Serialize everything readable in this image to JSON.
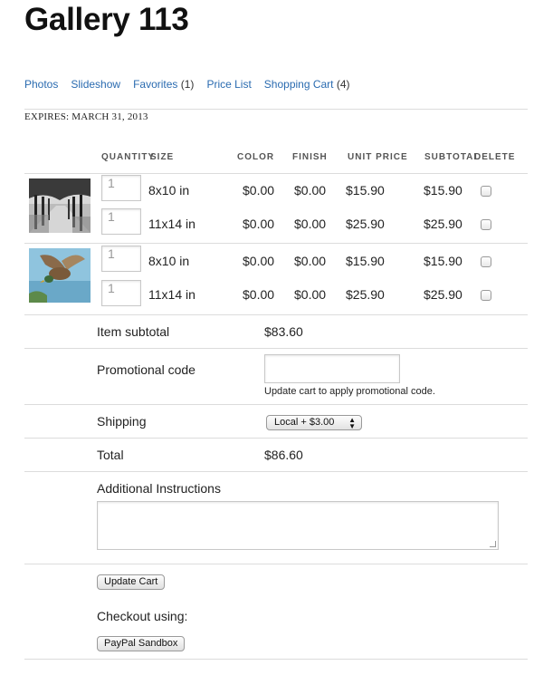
{
  "gallery": {
    "title": "Gallery 113",
    "expires": "EXPIRES: MARCH 31, 2013"
  },
  "nav": {
    "items": [
      {
        "label": "Photos",
        "count": ""
      },
      {
        "label": "Slideshow",
        "count": ""
      },
      {
        "label": "Favorites",
        "count": "(1)"
      },
      {
        "label": "Price List",
        "count": ""
      },
      {
        "label": "Shopping Cart",
        "count": "(4)"
      }
    ]
  },
  "table": {
    "headers": {
      "quantity": "QUANTITY",
      "size": "SIZE",
      "color": "COLOR",
      "finish": "FINISH",
      "unit_price": "UNIT PRICE",
      "subtotal": "SUBTOTAL",
      "delete": "DELETE"
    },
    "rows": [
      {
        "quantity_placeholder": "1",
        "size": "8x10 in",
        "color": "$0.00",
        "finish": "$0.00",
        "unit_price": "$15.90",
        "subtotal": "$15.90"
      },
      {
        "quantity_placeholder": "1",
        "size": "11x14 in",
        "color": "$0.00",
        "finish": "$0.00",
        "unit_price": "$25.90",
        "subtotal": "$25.90"
      },
      {
        "quantity_placeholder": "1",
        "size": "8x10 in",
        "color": "$0.00",
        "finish": "$0.00",
        "unit_price": "$15.90",
        "subtotal": "$15.90"
      },
      {
        "quantity_placeholder": "1",
        "size": "11x14 in",
        "color": "$0.00",
        "finish": "$0.00",
        "unit_price": "$25.90",
        "subtotal": "$25.90"
      }
    ]
  },
  "summary": {
    "item_subtotal_label": "Item subtotal",
    "item_subtotal_value": "$83.60",
    "promo_label": "Promotional code",
    "promo_value": "",
    "promo_hint": "Update cart to apply promotional code.",
    "shipping_label": "Shipping",
    "shipping_selected": "Local + $3.00",
    "total_label": "Total",
    "total_value": "$86.60",
    "instructions_label": "Additional Instructions",
    "instructions_value": ""
  },
  "actions": {
    "update_cart": "Update Cart",
    "checkout_label": "Checkout using:",
    "paypal": "PayPal Sandbox"
  },
  "colors": {
    "link": "#2a6bb0",
    "rule": "#dcdcdc"
  },
  "icons": {
    "shipping_select": "up-down-arrows-icon",
    "textarea_resize": "resize-grip-icon"
  }
}
